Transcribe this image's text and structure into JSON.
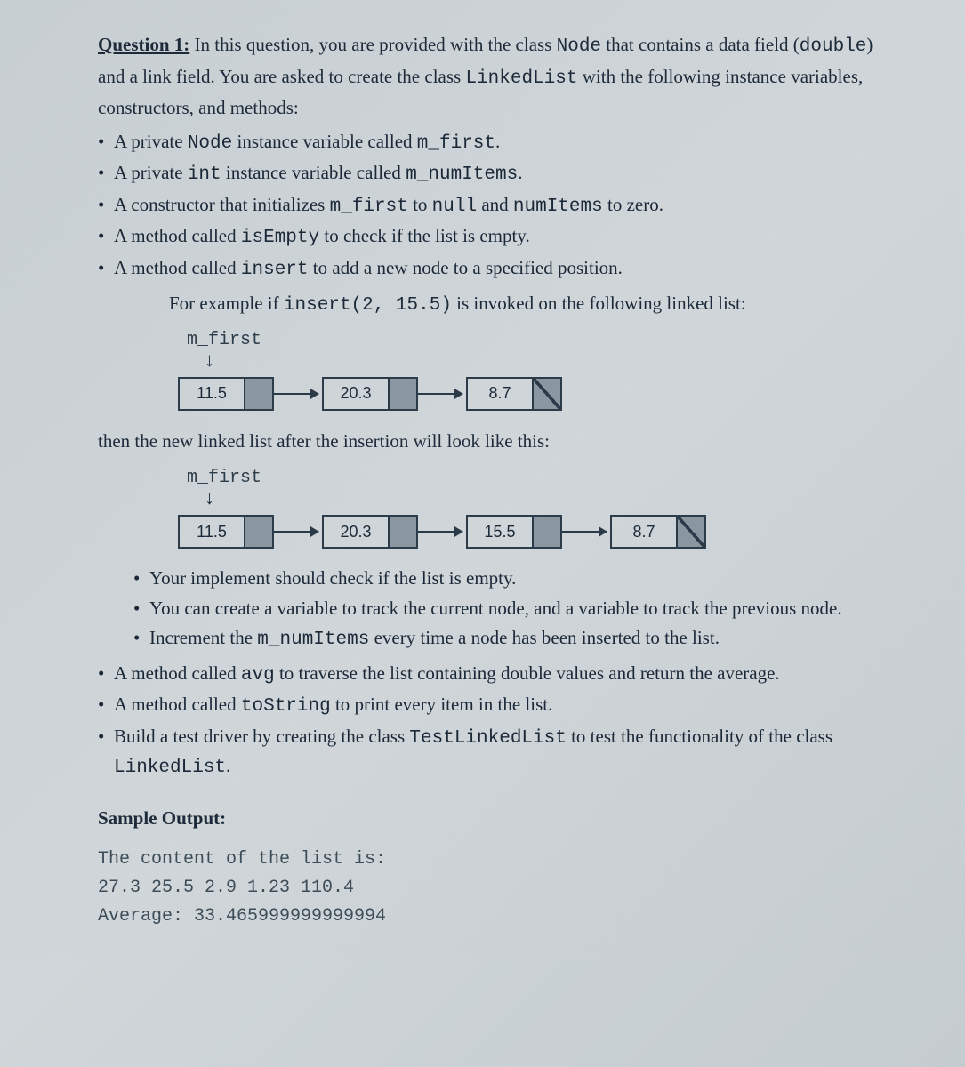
{
  "q": {
    "title": "Question 1:",
    "intro_a": " In this question, you are provided with the class ",
    "code_node": "Node",
    "intro_b": " that contains a data field (",
    "code_double": "double",
    "intro_c": ") and a link field. You are asked to create the class ",
    "code_ll": "LinkedList",
    "intro_d": " with the following instance variables, constructors, and methods:"
  },
  "bullets": {
    "b1_a": "A private ",
    "b1_code1": "Node",
    "b1_b": " instance variable called ",
    "b1_code2": "m_first",
    "b1_c": ".",
    "b2_a": "A private ",
    "b2_code1": "int",
    "b2_b": " instance variable called ",
    "b2_code2": "m_numItems",
    "b2_c": ".",
    "b3_a": "A constructor that initializes ",
    "b3_code1": "m_first",
    "b3_b": " to ",
    "b3_code2": "null",
    "b3_c": " and ",
    "b3_code3": "numItems",
    "b3_d": " to zero.",
    "b4_a": "A method called ",
    "b4_code1": "isEmpty",
    "b4_b": " to check if the list is empty.",
    "b5_a": "A method called ",
    "b5_code1": "insert",
    "b5_b": " to add a new node to a specified position."
  },
  "example": {
    "line1_a": "For example if ",
    "line1_code": "insert(2, 15.5)",
    "line1_b": " is invoked on the following linked list:",
    "m_first": "m_first",
    "after": "then the new linked list after the insertion will look like this:"
  },
  "ll1": {
    "n0": "11.5",
    "n1": "20.3",
    "n2": "8.7"
  },
  "ll2": {
    "n0": "11.5",
    "n1": "20.3",
    "n2": "15.5",
    "n3": "8.7"
  },
  "sub": {
    "s1": "Your implement should check if the list is empty.",
    "s2": "You can create a variable to track the current node, and a variable to track the previous node.",
    "s3_a": "Increment the ",
    "s3_code": "m_numItems",
    "s3_b": " every time a node has been inserted to the list."
  },
  "bullets2": {
    "b6_a": "A method called ",
    "b6_code": "avg",
    "b6_b": " to traverse the list containing double values and return the average.",
    "b7_a": "A method called ",
    "b7_code": "toString",
    "b7_b": " to print every item in the list.",
    "b8_a": "Build a test driver by creating the class ",
    "b8_code": "TestLinkedList",
    "b8_b": " to test the functionality of the class ",
    "b8_code2": "LinkedList",
    "b8_c": "."
  },
  "sample": {
    "head": "Sample Output:",
    "line1": "The content of the list is:",
    "line2": "27.3 25.5 2.9 1.23 110.4",
    "line3": "Average: 33.465999999999994"
  }
}
